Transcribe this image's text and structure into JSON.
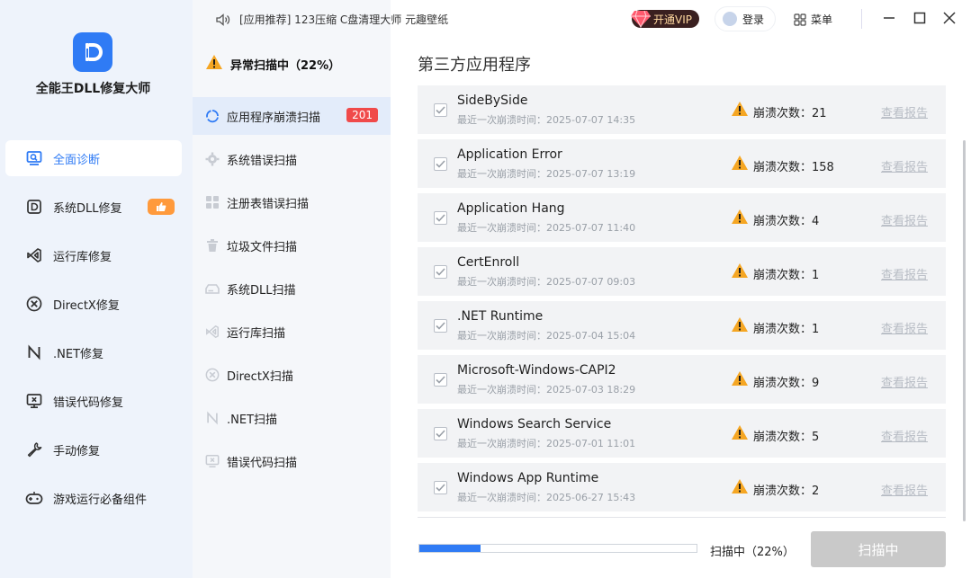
{
  "app": {
    "name": "全能王DLL修复大师"
  },
  "topbar": {
    "ad_text": "[应用推荐] 123压缩 C盘清理大师 元趣壁纸",
    "vip_label": "开通VIP",
    "login_label": "登录",
    "menu_label": "菜单"
  },
  "sidebar": {
    "items": [
      {
        "label": "全面诊断",
        "icon": "monitor-search-icon",
        "active": true
      },
      {
        "label": "系统DLL修复",
        "icon": "dll-icon"
      },
      {
        "label": "运行库修复",
        "icon": "visual-studio-icon"
      },
      {
        "label": "DirectX修复",
        "icon": "directx-icon"
      },
      {
        "label": ".NET修复",
        "icon": "dotnet-icon"
      },
      {
        "label": "错误代码修复",
        "icon": "error-monitor-icon"
      },
      {
        "label": "手动修复",
        "icon": "wrench-icon"
      },
      {
        "label": "游戏运行必备组件",
        "icon": "gamepad-icon"
      }
    ]
  },
  "scan": {
    "status": "异常扫描中（22%）",
    "progress": 0.22,
    "progress_text": "扫描中（22%）",
    "button_label": "扫描中"
  },
  "categories": [
    {
      "label": "应用程序崩溃扫描",
      "count": "201",
      "active": true
    },
    {
      "label": "系统错误扫描"
    },
    {
      "label": "注册表错误扫描"
    },
    {
      "label": "垃圾文件扫描"
    },
    {
      "label": "系统DLL扫描"
    },
    {
      "label": "运行库扫描"
    },
    {
      "label": "DirectX扫描"
    },
    {
      "label": ".NET扫描"
    },
    {
      "label": "错误代码扫描"
    }
  ],
  "main": {
    "title": "第三方应用程序",
    "crash_label": "崩溃次数：",
    "report_label": "查看报告",
    "rows": [
      {
        "name": "SideBySide",
        "time": "最近一次崩溃时间：2025-07-07 14:35",
        "count": "21"
      },
      {
        "name": "Application Error",
        "time": "最近一次崩溃时间：2025-07-07 13:19",
        "count": "158"
      },
      {
        "name": "Application Hang",
        "time": "最近一次崩溃时间：2025-07-07 11:40",
        "count": "4"
      },
      {
        "name": "CertEnroll",
        "time": "最近一次崩溃时间：2025-07-07 09:03",
        "count": "1"
      },
      {
        "name": ".NET Runtime",
        "time": "最近一次崩溃时间：2025-07-04 15:04",
        "count": "1"
      },
      {
        "name": "Microsoft-Windows-CAPI2",
        "time": "最近一次崩溃时间：2025-07-03 18:29",
        "count": "9"
      },
      {
        "name": "Windows Search Service",
        "time": "最近一次崩溃时间：2025-07-01 11:01",
        "count": "5"
      },
      {
        "name": "Windows App Runtime",
        "time": "最近一次崩溃时间：2025-06-27 15:43",
        "count": "2"
      }
    ]
  },
  "colors": {
    "accent": "#2f7bf5",
    "warning": "#f5a623",
    "badge": "#f04a4a"
  }
}
